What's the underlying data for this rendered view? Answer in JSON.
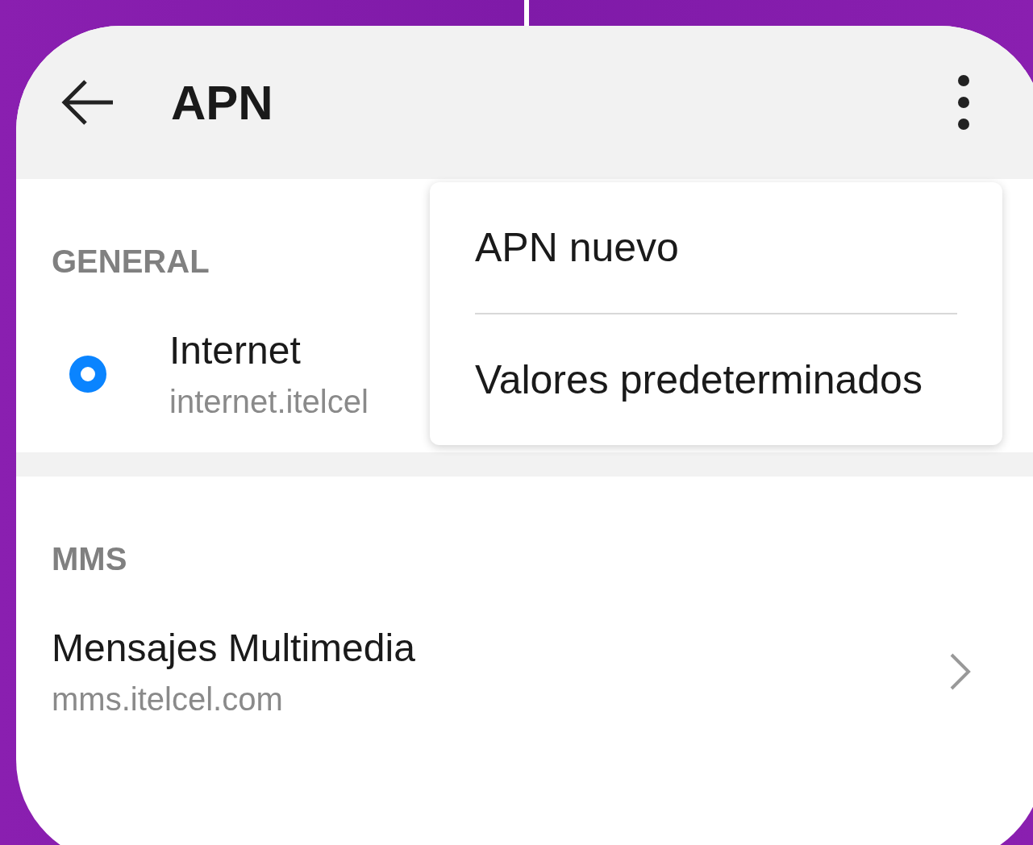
{
  "header": {
    "title": "APN"
  },
  "sections": [
    {
      "heading": "GENERAL",
      "items": [
        {
          "kind": "radio",
          "selected": true,
          "title": "Internet",
          "subtitle": "internet.itelcel"
        }
      ]
    },
    {
      "heading": "MMS",
      "items": [
        {
          "kind": "link",
          "title": "Mensajes Multimedia",
          "subtitle": "mms.itelcel.com"
        }
      ]
    }
  ],
  "menu": {
    "items": [
      "APN nuevo",
      "Valores predeterminados"
    ]
  }
}
